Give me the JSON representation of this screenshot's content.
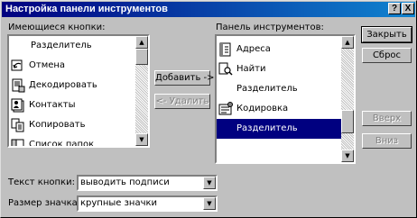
{
  "window": {
    "title": "Настройка панели инструментов",
    "help_label": "?",
    "close_label": "X"
  },
  "available": {
    "label": "Имеющиеся кнопки:",
    "items": [
      {
        "label": "Разделитель",
        "icon": "separator"
      },
      {
        "label": "Отмена",
        "icon": "undo-icon"
      },
      {
        "label": "Декодировать",
        "icon": "decode-icon"
      },
      {
        "label": "Контакты",
        "icon": "contacts-icon"
      },
      {
        "label": "Копировать",
        "icon": "copy-icon"
      },
      {
        "label": "Список папок",
        "icon": "folder-list-icon"
      }
    ]
  },
  "current": {
    "label": "Панель инструментов:",
    "items": [
      {
        "label": "Адреса",
        "icon": "addresses-icon"
      },
      {
        "label": "Найти",
        "icon": "find-icon"
      },
      {
        "label": "Разделитель",
        "icon": "separator"
      },
      {
        "label": "Кодировка",
        "icon": "encoding-icon"
      },
      {
        "label": "Разделитель",
        "icon": "separator",
        "selected": true
      }
    ]
  },
  "buttons": {
    "add": "Добавить ->",
    "remove": "<- Удалить",
    "close": "Закрыть",
    "reset": "Сброс",
    "up": "Вверх",
    "down": "Вниз"
  },
  "options": {
    "text_label": "Текст кнопки:",
    "text_value": "выводить подписи",
    "size_label": "Размер значка:",
    "size_value": "крупные значки"
  },
  "colors": {
    "face": "#c0c0c0",
    "title_start": "#000080",
    "title_end": "#1084d0",
    "selection": "#000080"
  }
}
